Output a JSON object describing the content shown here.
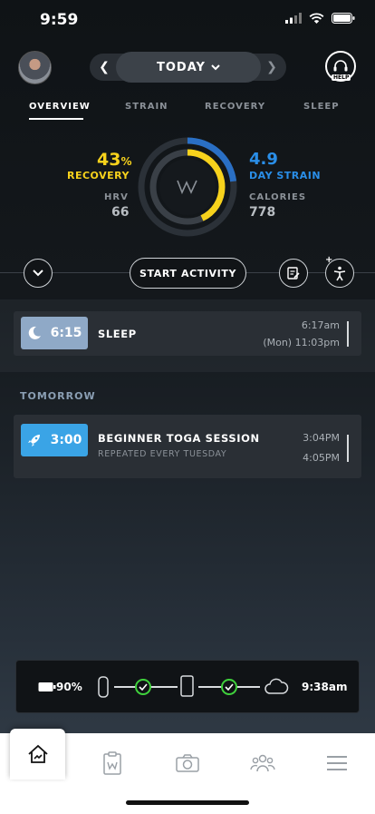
{
  "status_bar": {
    "time": "9:59"
  },
  "header": {
    "date_label": "TODAY",
    "help_label": "HELP"
  },
  "tabs": [
    {
      "label": "OVERVIEW",
      "active": true
    },
    {
      "label": "STRAIN",
      "active": false
    },
    {
      "label": "RECOVERY",
      "active": false
    },
    {
      "label": "SLEEP",
      "active": false
    }
  ],
  "overview": {
    "recovery": {
      "value": "43",
      "unit": "%",
      "label": "RECOVERY",
      "fraction": 0.43,
      "color": "#f7d21c"
    },
    "hrv": {
      "label": "HRV",
      "value": "66"
    },
    "strain": {
      "value": "4.9",
      "label": "DAY STRAIN",
      "fraction": 0.23,
      "color": "#2a8ee8"
    },
    "calories": {
      "label": "CALORIES",
      "value": "778"
    }
  },
  "actions": {
    "start_label": "START ACTIVITY"
  },
  "activities": {
    "today": [
      {
        "duration": "6:15",
        "title": "SLEEP",
        "time_start": "6:17am",
        "time_end": "(Mon) 11:03pm",
        "badge_color": "#8fa9c7",
        "icon": "moon-icon"
      }
    ],
    "tomorrow_label": "TOMORROW",
    "tomorrow": [
      {
        "duration": "3:00",
        "title": "BEGINNER TOGA SESSION",
        "subtitle": "REPEATED EVERY TUESDAY",
        "time_start": "3:04PM",
        "time_end": "4:05PM",
        "badge_color": "#3aa4e6",
        "icon": "rocket-icon"
      }
    ]
  },
  "sync": {
    "battery": "90%",
    "time": "9:38am",
    "status_color": "#3fd13c"
  },
  "bottom_nav": [
    {
      "name": "home-icon"
    },
    {
      "name": "journal-icon"
    },
    {
      "name": "camera-icon"
    },
    {
      "name": "community-icon"
    },
    {
      "name": "menu-icon"
    }
  ]
}
